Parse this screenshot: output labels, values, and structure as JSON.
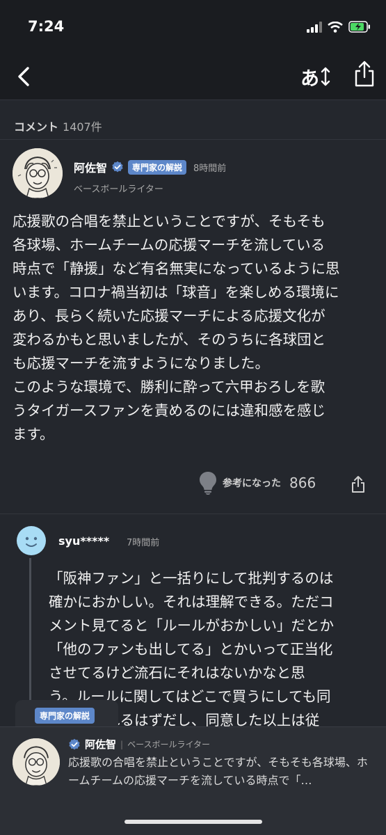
{
  "status": {
    "time": "7:24"
  },
  "nav": {
    "font_label": "あ"
  },
  "comments": {
    "heading": "コメント",
    "count": "1407件"
  },
  "top_comment": {
    "author": "阿佐智",
    "badge": "専門家の解説",
    "ago": "8時間前",
    "occupation": "ベースボールライター",
    "body": "応援歌の合唱を禁止ということですが、そもそも\n各球場、ホームチームの応援マーチを流している\n時点で「静援」など有名無実になっているように思\nいます。コロナ禍当初は「球音」を楽しめる環境に\nあり、長らく続いた応援マーチによる応援文化が\n変わるかもと思いましたが、そのうちに各球団と\nも応援マーチを流すようになりました。\nこのような環境で、勝利に酔って六甲おろしを歌\nうタイガースファンを責めるのには違和感を感じ\nます。",
    "reaction_label": "参考になった",
    "reaction_count": "866"
  },
  "reply": {
    "author": "syu*****",
    "ago": "7時間前",
    "body": "「阪神ファン」と一括りにして批判するのは\n確かにおかしい。それは理解できる。ただコ\nメント見てると「ルールがおかしい」だとか\n「他のファンも出してる」とかいって正当化\nさせてるけど流石にそれはないかなと思\nう。ルールに関してはどこで買うにしても同\n意させられるはずだし、同意した以上は従"
  },
  "bottom_panel": {
    "tab_badge": "専門家の解説",
    "author": "阿佐智",
    "separator": "|",
    "occupation": "ベースボールライター",
    "excerpt": "応援歌の合唱を禁止ということですが、そもそも各球場、ホームチームの応援マーチを流している時点で「…"
  },
  "colors": {
    "accent": "#5d87c9",
    "background": "#24272d",
    "bar": "#1a1c20"
  }
}
